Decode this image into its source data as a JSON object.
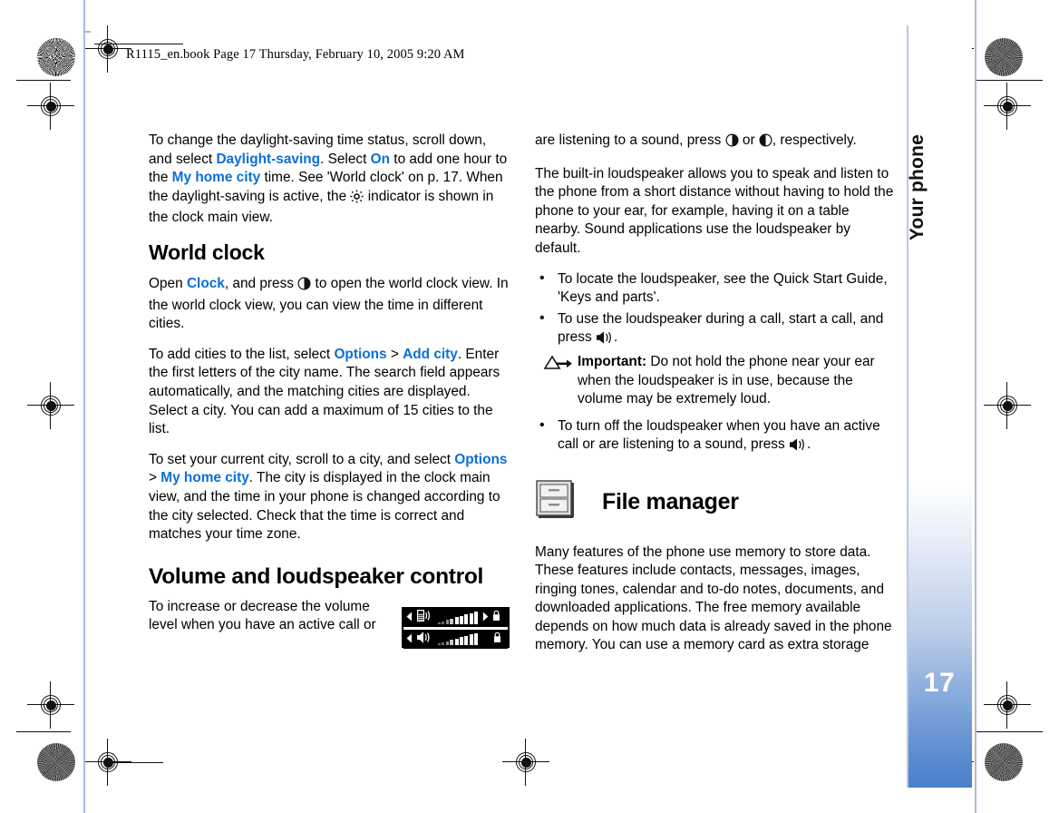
{
  "document": {
    "header_line": "R1115_en.book  Page 17  Thursday, February 10, 2005  9:20 AM",
    "page_number": "17",
    "chapter_title": "Your phone",
    "accent_blue": "#0b6fd6",
    "tab_gradient_end": "#4a7fc8"
  },
  "left_column": {
    "para_daylight": {
      "t1": "To change the daylight-saving time status, scroll down, and select ",
      "link1": "Daylight-saving",
      "t2": ". Select ",
      "link2": "On",
      "t3": " to add one hour to the ",
      "link3": "My home city",
      "t4": " time. See 'World clock' on p. 17. When the daylight-saving is active, the ",
      "icon": "sun-indicator-icon",
      "t5": " indicator is shown in the clock main view."
    },
    "heading_world_clock": "World clock",
    "para_open_clock": {
      "t1": "Open ",
      "link1": "Clock",
      "t2": ", and press ",
      "icon": "scroll-right-key-icon",
      "t3": " to open the world clock view. In the world clock view, you can view the time in different cities."
    },
    "para_add_cities": {
      "t1": "To add cities to the list, select ",
      "link1": "Options",
      "sep": " > ",
      "link2": "Add city",
      "t2": ". Enter the first letters of the city name. The search field appears automatically, and the matching cities are displayed. Select a city. You can add a maximum of 15 cities to the list."
    },
    "para_current_city": {
      "t1": "To set your current city, scroll to a city, and select ",
      "link1": "Options",
      "sep": " > ",
      "link2": "My home city",
      "t2": ". The city is displayed in the clock main view, and the time in your phone is changed according to the city selected. Check that the time is correct and matches your time zone."
    },
    "heading_volume": "Volume and loudspeaker control",
    "para_volume": "To increase or decrease the volume level when you have an active call or",
    "volume_graphic": {
      "name": "volume-level-indicator",
      "top_row_icon": "earpiece-speaker-icon",
      "bottom_row_icon": "loudspeaker-icon",
      "top_row_arrow": "scroll-right-arrow-icon",
      "top_row_lock": "lock-icon",
      "bottom_row_lock": "lock-icon",
      "segments_total": 10,
      "segments_filled": 7
    }
  },
  "right_column": {
    "para_listening": {
      "t1": "are listening to a sound, press ",
      "icon1": "scroll-right-key-icon",
      "t2": " or ",
      "icon2": "scroll-left-key-icon",
      "t3": ", respectively."
    },
    "para_builtin": "The built-in loudspeaker allows you to speak and listen to the phone from a short distance without having to hold the phone to your ear, for example, having it on a table nearby. Sound applications use the loudspeaker by default.",
    "bullets": [
      {
        "text": "To locate the loudspeaker, see the Quick Start Guide, 'Keys and parts'."
      },
      {
        "t1": "To use the loudspeaker during a call, start a call, and press ",
        "icon": "loudspeaker-icon",
        "t2": "."
      }
    ],
    "note": {
      "icon": "warning-triangle-icon",
      "label": "Important:",
      "text": " Do not hold the phone near your ear when the loudspeaker is in use, because the volume may be extremely loud."
    },
    "bullet_turn_off": {
      "t1": "To turn off the loudspeaker when you have an active call or are listening to a sound, press ",
      "icon": "loudspeaker-icon",
      "t2": "."
    },
    "heading_file_manager": "File manager",
    "file_manager_icon": "filing-cabinet-icon",
    "para_memory": "Many features of the phone use memory to store data. These features include contacts, messages, images, ringing tones, calendar and to-do notes, documents, and downloaded applications. The free memory available depends on how much data is already saved in the phone memory. You can use a memory card as extra storage"
  }
}
